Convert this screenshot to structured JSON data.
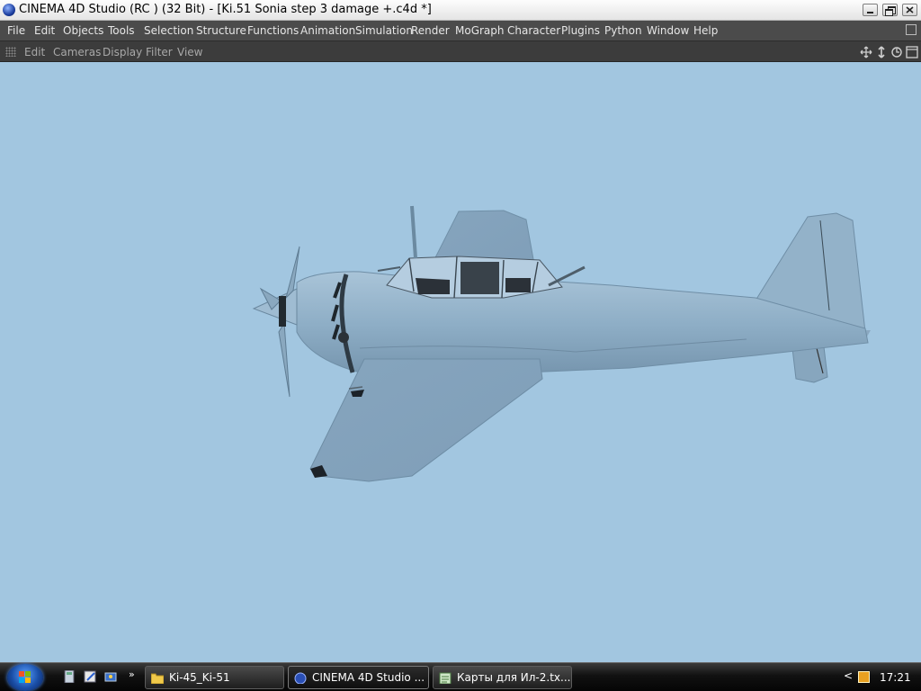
{
  "window": {
    "title": "CINEMA 4D Studio (RC ) (32 Bit) - [Ki.51 Sonia step 3 damage +.c4d *]"
  },
  "menubar": {
    "items": [
      "File",
      "Edit",
      "Objects",
      "Tools",
      "Selection",
      "Structure",
      "Functions",
      "Animation",
      "Simulation",
      "Render",
      "MoGraph",
      "Character",
      "Plugins",
      "Python",
      "Window",
      "Help"
    ]
  },
  "viewport_menu": {
    "items": [
      "Edit",
      "Cameras",
      "Display",
      "Filter",
      "View"
    ],
    "nav_icons": [
      "move-view-icon",
      "zoom-view-icon",
      "rotate-view-icon",
      "toggle-layout-icon"
    ]
  },
  "viewport": {
    "background": "#a2c6e0",
    "model_color": "#8fb0c8"
  },
  "taskbar": {
    "quicklaunch": [
      "calculator-icon",
      "paint-icon",
      "network-icon"
    ],
    "quicklaunch_more": "»",
    "tasks": [
      {
        "label": "Ki-45_Ki-51",
        "icon": "folder-icon",
        "active": false
      },
      {
        "label": "CINEMA 4D Studio ...",
        "icon": "cinema4d-icon",
        "active": true
      },
      {
        "label": "Карты для Ил-2.tx...",
        "icon": "notepad-icon",
        "active": false
      }
    ],
    "tray_chevron": "<",
    "clock": "17:21"
  }
}
